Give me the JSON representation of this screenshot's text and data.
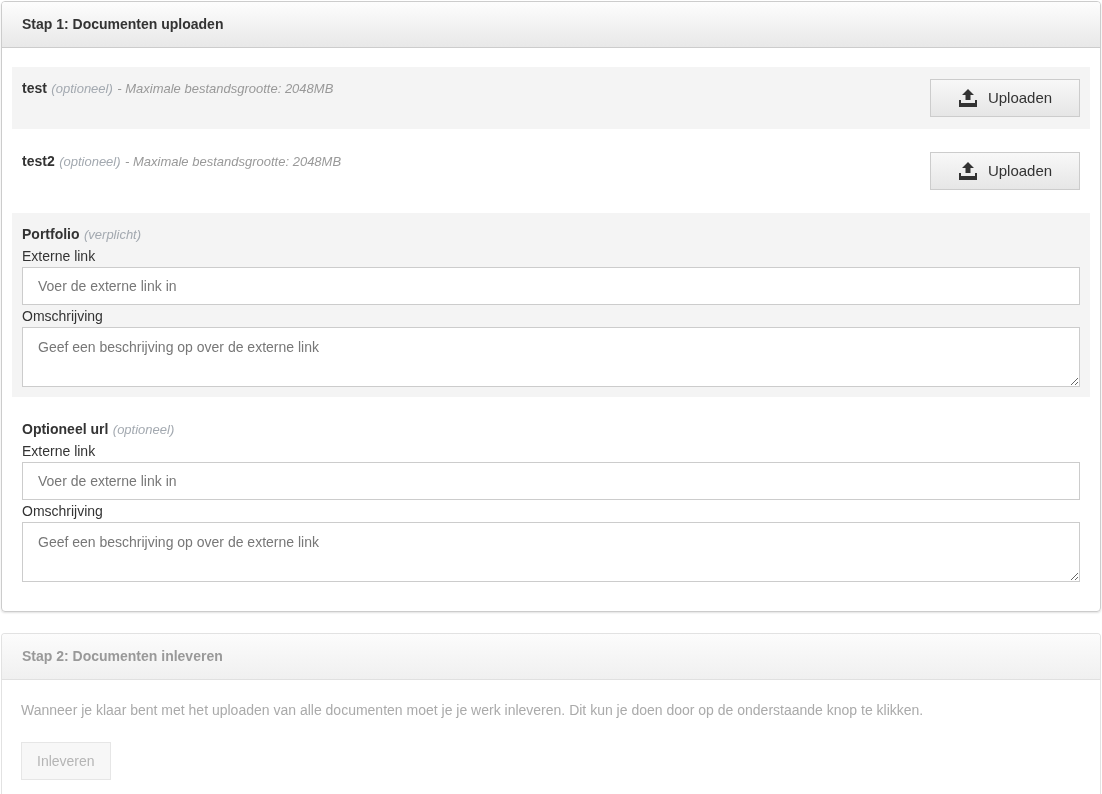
{
  "step_1": {
    "title": "Stap 1: Documenten uploaden",
    "disabled": false,
    "fields": [
      {
        "kind": "upload",
        "name": "test",
        "requirement": "(optioneel)",
        "note": "- Maximale bestandsgrootte: 2048MB",
        "button": "Uploaden"
      },
      {
        "kind": "upload",
        "name": "test2",
        "requirement": "(optioneel)",
        "note": "- Maximale bestandsgrootte: 2048MB",
        "button": "Uploaden"
      },
      {
        "kind": "link",
        "name": "Portfolio",
        "requirement": "(verplicht)",
        "link_label": "Externe link",
        "link_placeholder": "Voer de externe link in",
        "description_label": "Omschrijving",
        "description_placeholder": "Geef een beschrijving op over de externe link"
      },
      {
        "kind": "link",
        "name": "Optioneel url",
        "requirement": "(optioneel)",
        "link_label": "Externe link",
        "link_placeholder": "Voer de externe link in",
        "description_label": "Omschrijving",
        "description_placeholder": "Geef een beschrijving op over de externe link"
      }
    ]
  },
  "step_2": {
    "title": "Stap 2: Documenten inleveren",
    "disabled": true,
    "text": "Wanneer je klaar bent met het uploaden van alle documenten moet je je werk inleveren. Dit kun je doen door op de onderstaande knop te klikken.",
    "button": "Inleveren"
  }
}
